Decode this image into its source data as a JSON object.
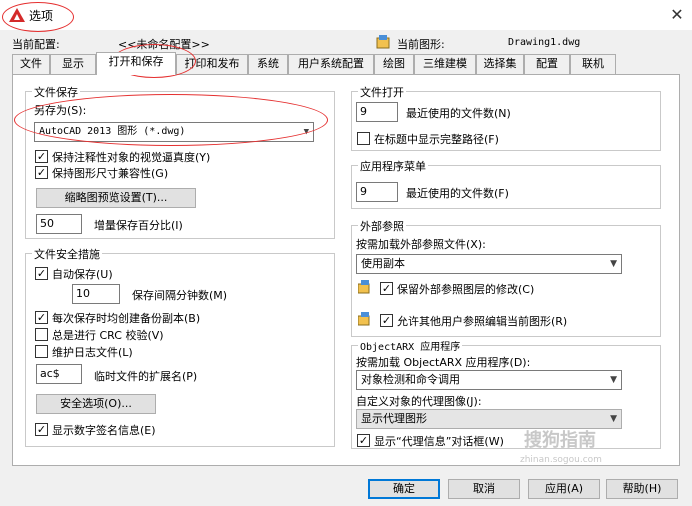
{
  "window": {
    "title": "选项",
    "close_glyph": "✕"
  },
  "header": {
    "current_profile_label": "当前配置:",
    "current_profile_value": "<<未命名配置>>",
    "current_drawing_label": "当前图形:",
    "current_drawing_value": "Drawing1.dwg"
  },
  "tabs": [
    "文件",
    "显示",
    "打开和保存",
    "打印和发布",
    "系统",
    "用户系统配置",
    "绘图",
    "三维建模",
    "选择集",
    "配置",
    "联机"
  ],
  "left": {
    "file_save": {
      "title": "文件保存",
      "save_as_label": "另存为(S):",
      "save_as_value": "AutoCAD 2013 图形 (*.dwg)",
      "annot_visual_fidelity": {
        "label": "保持注释性对象的视觉逼真度(Y)",
        "checked": true
      },
      "drawing_size_compat": {
        "label": "保持图形尺寸兼容性(G)",
        "checked": true
      },
      "thumbnail_button": "缩略图预览设置(T)...",
      "incremental_value": "50",
      "incremental_label": "增量保存百分比(I)"
    },
    "file_safety": {
      "title": "文件安全措施",
      "autosave": {
        "label": "自动保存(U)",
        "checked": true
      },
      "interval_value": "10",
      "interval_label": "保存间隔分钟数(M)",
      "backup_copy": {
        "label": "每次保存时均创建备份副本(B)",
        "checked": true
      },
      "crc_check": {
        "label": "总是进行 CRC 校验(V)",
        "checked": false
      },
      "log_file": {
        "label": "维护日志文件(L)",
        "checked": false
      },
      "temp_ext_value": "ac$",
      "temp_ext_label": "临时文件的扩展名(P)",
      "security_button": "安全选项(O)...",
      "digital_signature": {
        "label": "显示数字签名信息(E)",
        "checked": true
      }
    }
  },
  "right": {
    "file_open": {
      "title": "文件打开",
      "recent_value": "9",
      "recent_label": "最近使用的文件数(N)",
      "full_path": {
        "label": "在标题中显示完整路径(F)",
        "checked": false
      }
    },
    "app_menu": {
      "title": "应用程序菜单",
      "recent_value": "9",
      "recent_label": "最近使用的文件数(F)"
    },
    "xref": {
      "title": "外部参照",
      "demand_load_label": "按需加载外部参照文件(X):",
      "demand_load_value": "使用副本",
      "retain_changes": {
        "label": "保留外部参照图层的修改(C)",
        "checked": true
      },
      "allow_edit": {
        "label": "允许其他用户参照编辑当前图形(R)",
        "checked": true
      }
    },
    "objectarx": {
      "title": "ObjectARX 应用程序",
      "demand_load_label": "按需加载 ObjectARX 应用程序(D):",
      "demand_load_value": "对象检测和命令调用",
      "proxy_images_label": "自定义对象的代理图像(J):",
      "proxy_images_value": "显示代理图形",
      "proxy_dialog": {
        "label": "显示“代理信息”对话框(W)",
        "checked": true
      }
    }
  },
  "footer": {
    "ok": "确定",
    "cancel": "取消",
    "apply": "应用(A)",
    "help": "帮助(H)"
  },
  "watermark": {
    "line1": "搜狗指南",
    "line2": "zhinan.sogou.com"
  },
  "colors": {
    "accent": "#0078d7",
    "annotation_circle": "#e53030",
    "app_icon": "#d42a2a"
  }
}
